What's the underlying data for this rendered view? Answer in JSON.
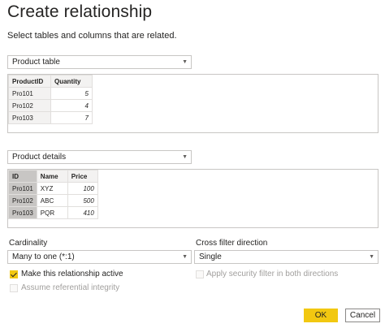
{
  "dialog": {
    "title": "Create relationship",
    "subtitle": "Select tables and columns that are related."
  },
  "table1": {
    "selected": "Product table",
    "caret_icon": "chevron-down-icon",
    "columns": [
      "ProductID",
      "Quantity"
    ],
    "rows": [
      [
        "Pro101",
        "5"
      ],
      [
        "Pro102",
        "4"
      ],
      [
        "Pro103",
        "7"
      ]
    ]
  },
  "table2": {
    "selected": "Product details",
    "caret_icon": "chevron-down-icon",
    "columns": [
      "ID",
      "Name",
      "Price"
    ],
    "rows": [
      [
        "Pro101",
        "XYZ",
        "100"
      ],
      [
        "Pro102",
        "ABC",
        "500"
      ],
      [
        "Pro103",
        "PQR",
        "410"
      ]
    ]
  },
  "cardinality": {
    "label": "Cardinality",
    "value": "Many to one (*:1)"
  },
  "cross_filter": {
    "label": "Cross filter direction",
    "value": "Single"
  },
  "options": {
    "make_active": {
      "label": "Make this relationship active",
      "checked": true
    },
    "referential_integrity": {
      "label": "Assume referential integrity",
      "checked": false,
      "disabled": true
    },
    "security_filter": {
      "label": "Apply security filter in both directions",
      "checked": false,
      "disabled": true
    }
  },
  "buttons": {
    "ok": "OK",
    "cancel": "Cancel"
  },
  "colors": {
    "accent": "#f2c811",
    "border": "#c8c6c4",
    "header_bg": "#f3f2f1",
    "selected_column": "#c8c6c4"
  }
}
